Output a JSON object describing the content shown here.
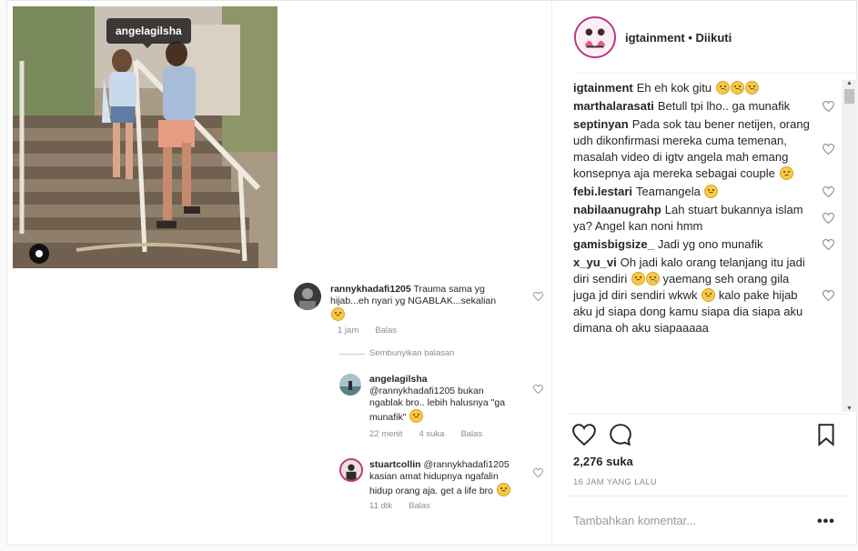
{
  "post": {
    "photo_tag_username": "angelagilsha",
    "embedded_comments": {
      "c1": {
        "user": "rannykhadafi1205",
        "text_line1": "Trauma sama yg",
        "text_line2": "hijab...eh nyari yg NGABLAK...sekalian",
        "time": "1 jam",
        "reply": "Balas"
      },
      "hide_replies": "Sembunyikan balasan",
      "c2": {
        "user": "angelagilsha",
        "text_line1": "@rannykhadafi1205 bukan",
        "text_line2": "ngablak bro.. lebih halusnya \"ga",
        "text_line3": "munafik\"",
        "time": "22 menit",
        "likes": "4 suka",
        "reply": "Balas"
      },
      "c3": {
        "user": "stuartcollin",
        "mention": "@rannykhadafi1205",
        "text_line2": "kasian amat hidupnya ngafalin",
        "text_line3": "hidup orang aja. get a life bro",
        "time": "11 dtk",
        "reply": "Balas"
      }
    }
  },
  "header": {
    "username": "igtainment",
    "separator": " • ",
    "follow_status": "Diikuti"
  },
  "comments": [
    {
      "user": "igtainment",
      "text": "Eh eh kok gitu",
      "emojis": [
        "tear",
        "tear",
        "tear"
      ]
    },
    {
      "user": "marthalarasati",
      "text": "Betull tpi lho.. ga munafik",
      "emojis": []
    },
    {
      "user": "septinyan",
      "text": "Pada sok tau bener netijen, orang udh dikonfirmasi mereka cuma temenan, masalah video di igtv angela mah emang konsepnya aja mereka sebagai couple",
      "emojis": [
        "sad"
      ]
    },
    {
      "user": "febi.lestari",
      "text": "Teamangela",
      "emojis": [
        "smile"
      ]
    },
    {
      "user": "nabilaanugrahp",
      "text": "Lah stuart bukannya islam ya? Angel kan noni hmm",
      "emojis": []
    },
    {
      "user": "gamisbigsize_",
      "text": "Jadi yg ono munafik",
      "emojis": []
    },
    {
      "user": "x_yu_vi",
      "text_a": "Oh jadi kalo orang telanjang itu jadi diri sendiri",
      "text_b": "yaemang seh orang gila juga jd diri sendiri wkwk",
      "text_c": "kalo pake hijab aku jd siapa dong kamu siapa dia siapa aku dimana oh aku siapaaaaa"
    }
  ],
  "likes": "2,276 suka",
  "timestamp": "16 JAM YANG LALU",
  "add_comment_placeholder": "Tambahkan komentar...",
  "more_label": "•••",
  "colors": {
    "accent_ring": "#c13584",
    "text": "#262626",
    "muted": "#8e8e8e",
    "border": "#efefef"
  }
}
